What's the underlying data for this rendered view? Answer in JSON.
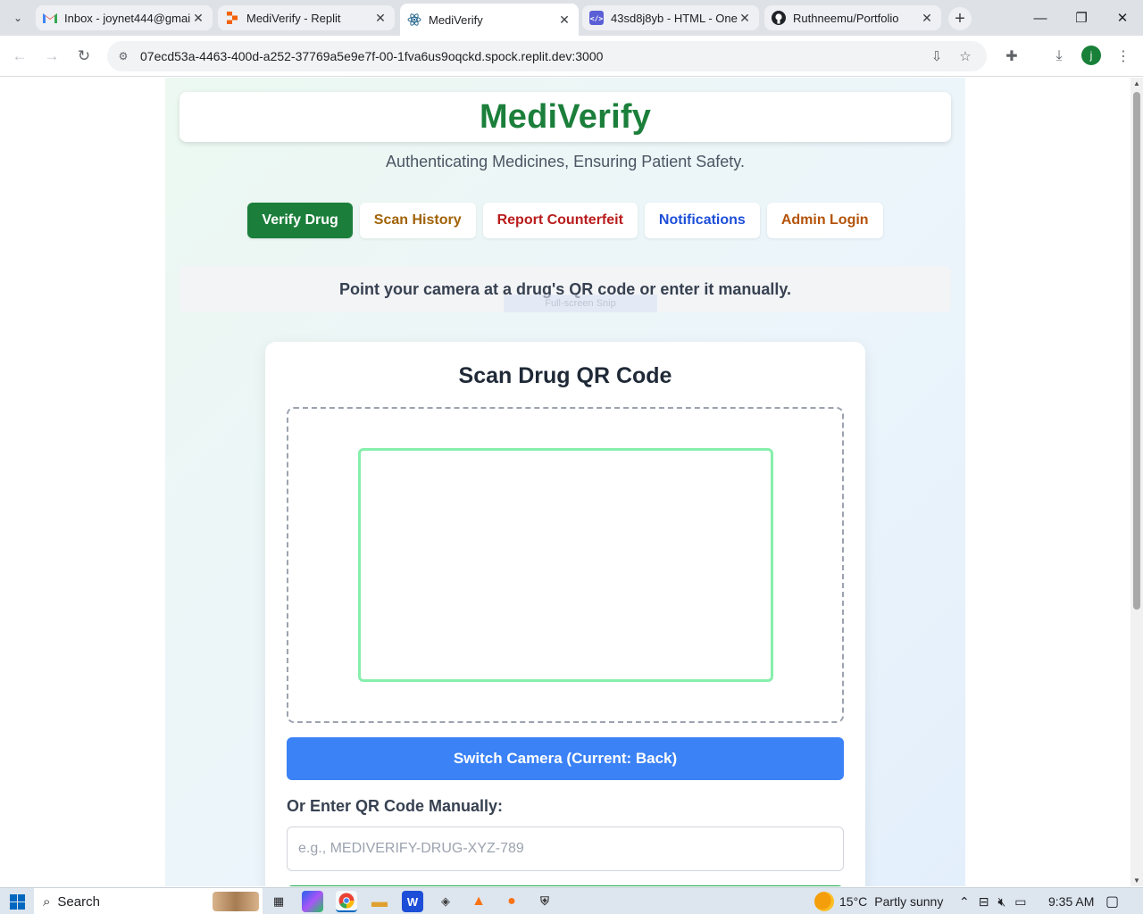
{
  "browser": {
    "tabs": [
      {
        "title": "Inbox - joynet444@gmail",
        "icon": "gmail-icon",
        "active": false
      },
      {
        "title": "MediVerify - Replit",
        "icon": "replit-icon",
        "active": false
      },
      {
        "title": "MediVerify",
        "icon": "react-icon",
        "active": true
      },
      {
        "title": "43sd8j8yb - HTML - One(",
        "icon": "code-icon",
        "active": false
      },
      {
        "title": "Ruthneemu/Portfolio",
        "icon": "github-icon",
        "active": false
      }
    ],
    "new_tab": "+",
    "url": "07ecd53a-4463-400d-a252-37769a5e9e7f-00-1fva6us9oqckd.spock.replit.dev:3000",
    "profile_initial": "j"
  },
  "page": {
    "brand": "MediVerify",
    "tagline": "Authenticating Medicines, Ensuring Patient Safety.",
    "nav": [
      {
        "label": "Verify Drug",
        "active": true
      },
      {
        "label": "Scan History",
        "color": "#a16207"
      },
      {
        "label": "Report Counterfeit",
        "color": "#b91c1c"
      },
      {
        "label": "Notifications",
        "color": "#1d4ed8"
      },
      {
        "label": "Admin Login",
        "color": "#b45309"
      }
    ],
    "instruction": "Point your camera at a drug's QR code or enter it manually.",
    "snip_overlay": "Full-screen Snip",
    "scan": {
      "title": "Scan Drug QR Code",
      "switch_camera": "Switch Camera (Current: Back)",
      "manual_label": "Or Enter QR Code Manually:",
      "manual_placeholder": "e.g., MEDIVERIFY-DRUG-XYZ-789",
      "manual_value": ""
    }
  },
  "colors": {
    "brand_green": "#1b7f3b",
    "scan_frame": "#86efac",
    "switch_blue": "#3b82f6"
  },
  "taskbar": {
    "search": "Search",
    "weather": "15°C",
    "weather_text": "Partly sunny",
    "time": "9:35 AM"
  }
}
